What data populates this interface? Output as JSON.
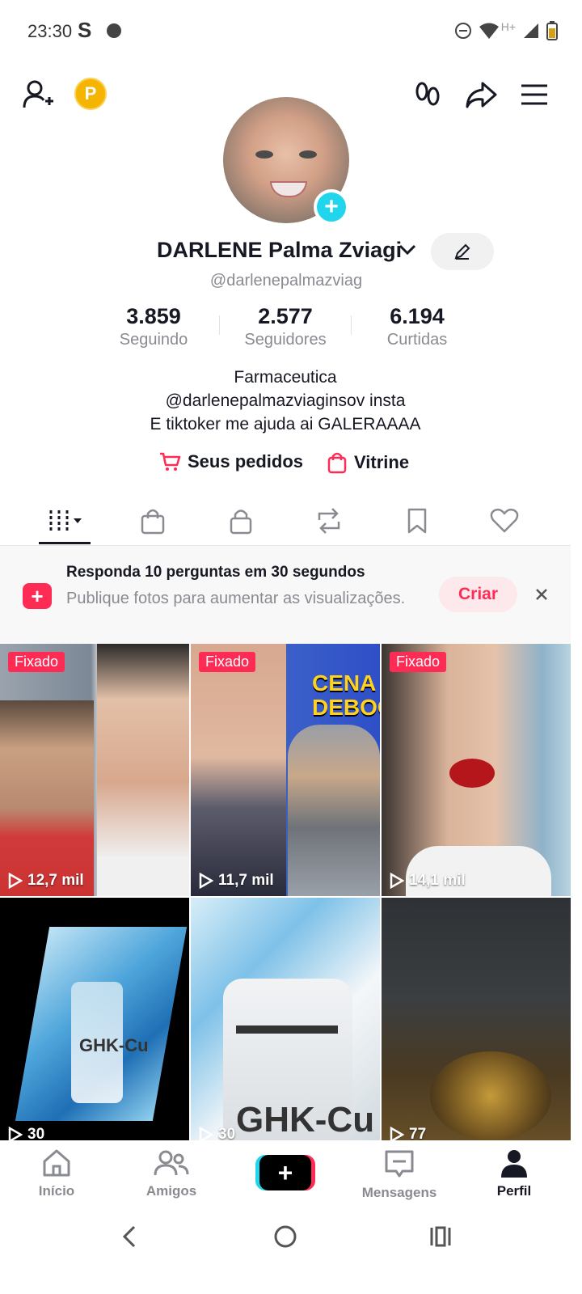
{
  "status_bar": {
    "time": "23:30",
    "network": "H+"
  },
  "header": {
    "coin_label": "P"
  },
  "profile": {
    "name": "DARLENE Palma Zviagi",
    "handle": "@darlenepalmazviag",
    "stats": [
      {
        "value": "3.859",
        "label": "Seguindo"
      },
      {
        "value": "2.577",
        "label": "Seguidores"
      },
      {
        "value": "6.194",
        "label": "Curtidas"
      }
    ],
    "bio_lines": [
      "Farmaceutica",
      "@darlenepalmazviaginsov insta",
      "E tiktoker me ajuda ai GALERAAAA"
    ],
    "orders_label": "Seus pedidos",
    "showcase_label": "Vitrine"
  },
  "tabs": [
    "videos-icon",
    "shop-icon",
    "lock-icon",
    "repost-icon",
    "bookmark-icon",
    "heart-icon"
  ],
  "banner": {
    "title": "Responda 10 perguntas em 30 segundos",
    "subtitle": "Publique fotos para aumentar as visualizações.",
    "button": "Criar"
  },
  "videos": [
    {
      "pinned": "Fixado",
      "views": "12,7 mil"
    },
    {
      "pinned": "Fixado",
      "views": "11,7 mil",
      "overlay": "CENA D DEBOCH"
    },
    {
      "pinned": "Fixado",
      "views": "14,1 mil"
    },
    {
      "views": "30",
      "overlay": "GHK-Cu"
    },
    {
      "views": "30",
      "overlay": "GHK-Cu"
    },
    {
      "views": "77"
    }
  ],
  "bottom_nav": [
    {
      "label": "Início"
    },
    {
      "label": "Amigos"
    },
    {
      "label": ""
    },
    {
      "label": "Mensagens"
    },
    {
      "label": "Perfil"
    }
  ],
  "colors": {
    "accent": "#fe2c55",
    "cyan": "#20d5ec",
    "text": "#161823",
    "muted": "#8a8b91"
  }
}
